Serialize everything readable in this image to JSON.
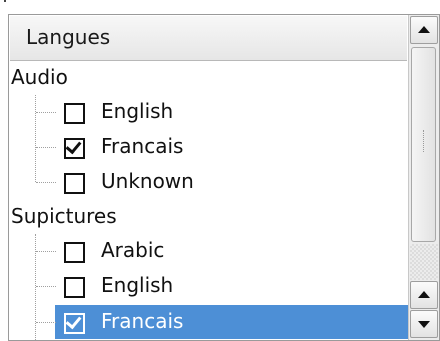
{
  "header": {
    "title": "Langues"
  },
  "tree": {
    "groups": [
      {
        "label": "Audio",
        "items": [
          {
            "label": "English",
            "checked": false
          },
          {
            "label": "Francais",
            "checked": true
          },
          {
            "label": "Unknown",
            "checked": false
          }
        ]
      },
      {
        "label": "Supictures",
        "items": [
          {
            "label": "Arabic",
            "checked": false
          },
          {
            "label": "English",
            "checked": false
          },
          {
            "label": "Francais",
            "checked": true,
            "selected": true
          }
        ]
      }
    ]
  },
  "icons": {
    "scroll_up": "arrow-up-icon",
    "scroll_down": "arrow-down-icon",
    "checkbox": "checkbox-icon"
  },
  "colors": {
    "selection": "#4d8fd6",
    "border": "#9a9a9a",
    "header_bg": "#eeeeee"
  }
}
